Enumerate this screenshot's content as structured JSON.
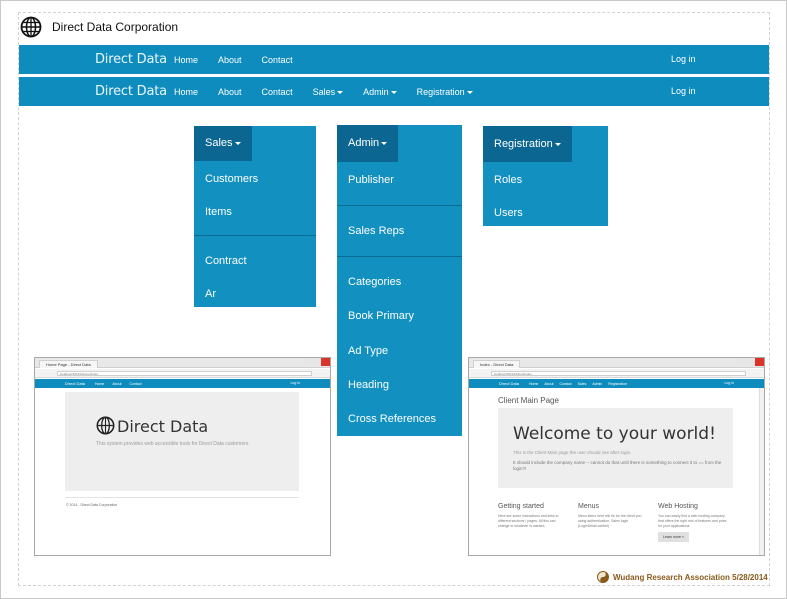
{
  "doc": {
    "title": "Direct Data Corporation",
    "credit": "Wudang Research Association 5/28/2014"
  },
  "navbar_simple": {
    "brand": "Direct Data",
    "links": [
      "Home",
      "About",
      "Contact"
    ],
    "login": "Log in"
  },
  "navbar_full": {
    "brand": "Direct Data",
    "links": [
      "Home",
      "About",
      "Contact",
      "Sales",
      "Admin",
      "Registration"
    ],
    "login": "Log in"
  },
  "menus": {
    "sales": {
      "label": "Sales",
      "items": [
        "Customers",
        "Items",
        "Contract",
        "Ar"
      ]
    },
    "admin": {
      "label": "Admin",
      "items": [
        "Publisher",
        "Sales Reps",
        "Categories",
        "Book Primary",
        "Ad Type",
        "Heading",
        "Cross References"
      ]
    },
    "registration": {
      "label": "Registration",
      "items": [
        "Roles",
        "Users"
      ]
    }
  },
  "shot_left": {
    "tab": "Home Page - Direct Data",
    "url": "localhost:56134/Home/Index",
    "nav_brand": "Direct Data",
    "nav_links": [
      "Home",
      "About",
      "Contact"
    ],
    "nav_login": "Log in",
    "hero_title": "Direct Data",
    "hero_text": "This system provides web accessible tools for Direct Data customers.",
    "footer": "© 2014 - Direct Data Corporation"
  },
  "shot_right": {
    "tab": "Index - Direct Data",
    "url": "localhost:56134/Client/Index",
    "nav_brand": "Direct Data",
    "nav_links": [
      "Home",
      "About",
      "Contact",
      "Sales",
      "Admin",
      "Registration"
    ],
    "nav_login": "Log in",
    "page_title": "Client Main Page",
    "hero_title": "Welcome to your world!",
    "hero_line1": "This is the Client Main page the user should see after login.",
    "hero_line2": "It should include the company name -- cannot do that until there is something to connect it to == from the login?!",
    "col1_title": "Getting started",
    "col1_text": "Here are some instructions and links to different sections / pages. All this can change to whatever is wanted.",
    "col2_title": "Menus",
    "col2_text": "Menu items here will be for the client you using authentication. Sales login (LoginDetail.cshtml)",
    "col3_title": "Web Hosting",
    "col3_text": "You can easily find a web hosting company that offers the right mix of features and price for your applications.",
    "col3_button": "Learn more »"
  },
  "colors": {
    "nav": "#0e8cbd",
    "menu": "#1290c0",
    "menu_active": "#0b6791",
    "credit": "#8a5a1a"
  }
}
